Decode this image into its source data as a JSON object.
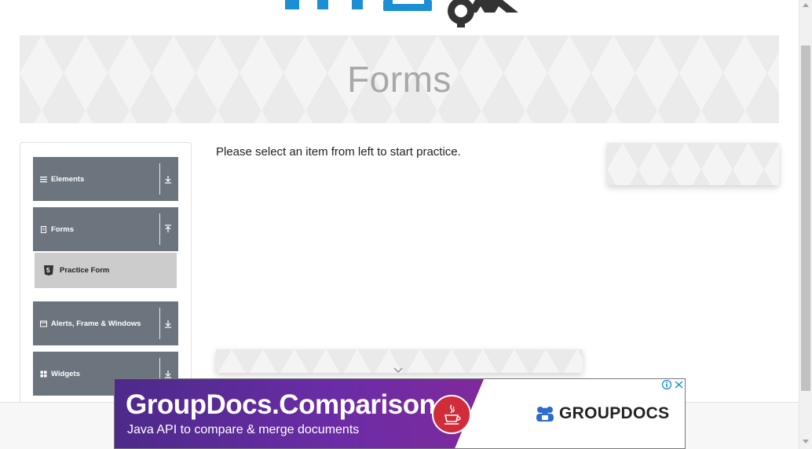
{
  "banner": {
    "title": "Forms"
  },
  "sidebar": {
    "groups": [
      {
        "label": "Elements",
        "icon": "list-icon",
        "arrow": "download-arrow-icon"
      },
      {
        "label": "Forms",
        "icon": "document-icon",
        "arrow": "upload-arrow-icon"
      },
      {
        "label": "Alerts, Frame & Windows",
        "icon": "window-icon",
        "arrow": "download-arrow-icon"
      },
      {
        "label": "Widgets",
        "icon": "grid-icon",
        "arrow": "download-arrow-icon"
      }
    ],
    "forms_items": [
      {
        "label": "Practice Form",
        "icon": "html5-icon"
      }
    ]
  },
  "main": {
    "prompt_text": "Please select an item from left to start practice."
  },
  "ad": {
    "title": "GroupDocs.Comparison",
    "subtitle": "Java API to compare & merge documents",
    "brand": "GROUPDOCS",
    "colors": {
      "primary": "#6b2ca6",
      "accent": "#d02c39",
      "brand_blue": "#2e6bd1"
    }
  },
  "colors": {
    "group_bg": "#6c757d",
    "selected_item_bg": "#cccccc",
    "banner_title": "#a8a8a8"
  }
}
